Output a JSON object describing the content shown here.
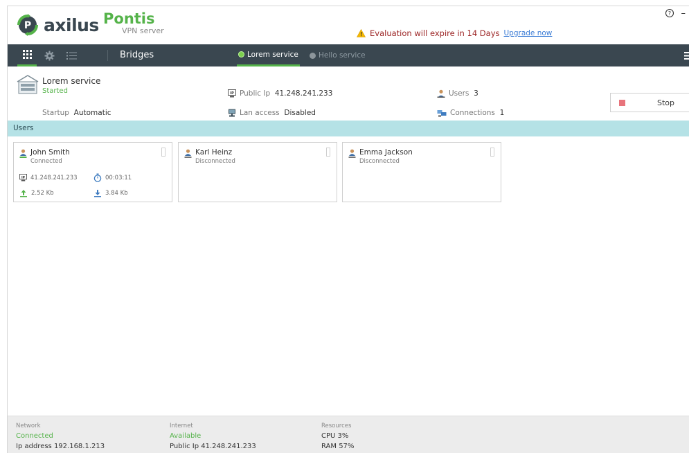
{
  "brand": {
    "name": "axilus",
    "product": "Pontis",
    "subtitle": "VPN server",
    "accent": "#55b34a",
    "dark": "#3a4750"
  },
  "evaluation": {
    "message": "Evaluation will expire in 14 Days",
    "link": "Upgrade now"
  },
  "window": {
    "help": "?",
    "minimize": "–"
  },
  "nav": {
    "icons": [
      "grid-icon",
      "gear-icon",
      "list-icon"
    ],
    "section": "Bridges",
    "services": [
      {
        "label": "Lorem service",
        "active": true,
        "dot": "#7ccf4e"
      },
      {
        "label": "Hello service",
        "active": false,
        "dot": "#8c959b"
      }
    ]
  },
  "service": {
    "name": "Lorem service",
    "status": "Started",
    "startup_label": "Startup",
    "startup_value": "Automatic",
    "public_ip_label": "Public Ip",
    "public_ip_value": "41.248.241.233",
    "lan_label": "Lan access",
    "lan_value": "Disabled",
    "users_label": "Users",
    "users_value": "3",
    "connections_label": "Connections",
    "connections_value": "1",
    "stop_label": "Stop"
  },
  "users_section": {
    "title": "Users"
  },
  "users": [
    {
      "name": "John Smith",
      "state": "Connected",
      "ip": "41.248.241.233",
      "duration": "00:03:11",
      "upload": "2.52 Kb",
      "download": "3.84 Kb"
    },
    {
      "name": "Karl Heinz",
      "state": "Disconnected"
    },
    {
      "name": "Emma Jackson",
      "state": "Disconnected"
    }
  ],
  "footer": {
    "network": {
      "label": "Network",
      "status": "Connected",
      "detail": "Ip address 192.168.1.213"
    },
    "internet": {
      "label": "Internet",
      "status": "Available",
      "detail": "Public Ip 41.248.241.233"
    },
    "resources": {
      "label": "Resources",
      "cpu": "CPU 3%",
      "ram": "RAM 57%"
    }
  }
}
